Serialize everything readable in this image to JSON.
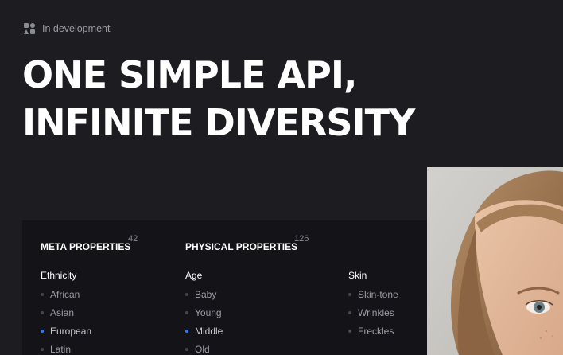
{
  "status_badge": {
    "icon": "shapes-icon",
    "text": "In development"
  },
  "hero": {
    "title_line_1": "ONE SIMPLE API,",
    "title_line_2": "INFINITE DIVERSITY"
  },
  "sections": {
    "meta": {
      "title": "META PROPERTIES",
      "count": "42"
    },
    "physical": {
      "title": "PHYSICAL PROPERTIES",
      "count": "126"
    }
  },
  "groups": {
    "ethnicity": {
      "title": "Ethnicity",
      "items": [
        "African",
        "Asian",
        "European",
        "Latin"
      ],
      "selected": "European"
    },
    "age": {
      "title": "Age",
      "items": [
        "Baby",
        "Young",
        "Middle",
        "Old"
      ],
      "selected": "Middle"
    },
    "skin": {
      "title": "Skin",
      "items": [
        "Skin-tone",
        "Wrinkles",
        "Freckles"
      ],
      "selected": ""
    }
  },
  "colors": {
    "background": "#1d1c21",
    "panel": "#141318",
    "accent": "#2a7fff",
    "muted_dot": "#46464e"
  }
}
